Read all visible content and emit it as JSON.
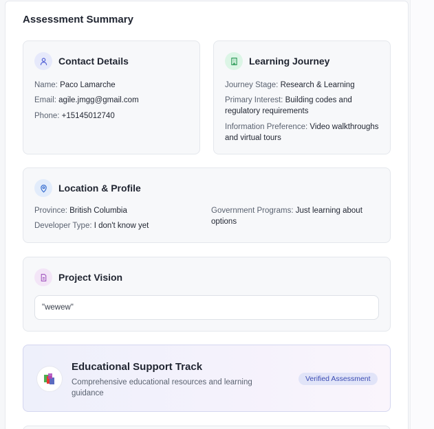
{
  "summary": {
    "title": "Assessment Summary"
  },
  "contact": {
    "title": "Contact Details",
    "name_label": "Name:",
    "name": "Paco Lamarche",
    "email_label": "Email:",
    "email": "agile.jmgg@gmail.com",
    "phone_label": "Phone:",
    "phone": "+15145012740"
  },
  "journey": {
    "title": "Learning Journey",
    "stage_label": "Journey Stage:",
    "stage": "Research & Learning",
    "interest_label": "Primary Interest:",
    "interest": "Building codes and regulatory requirements",
    "pref_label": "Information Preference:",
    "pref": "Video walkthroughs and virtual tours"
  },
  "location": {
    "title": "Location & Profile",
    "province_label": "Province:",
    "province": "British Columbia",
    "developer_label": "Developer Type:",
    "developer": "I don't know yet",
    "programs_label": "Government Programs:",
    "programs": "Just learning about options"
  },
  "vision": {
    "title": "Project Vision",
    "value": "\"wewew\""
  },
  "track": {
    "title": "Educational Support Track",
    "description": "Comprehensive educational resources and learning guidance",
    "badge": "Verified Assessment"
  },
  "colors": {
    "contact_icon_bg": "#e6e9fb",
    "contact_icon": "#5563d6",
    "journey_icon_bg": "#dcf5e6",
    "journey_icon": "#2e9c5a",
    "location_icon_bg": "#e2ecfb",
    "location_icon": "#3a6fd0",
    "vision_icon_bg": "#f3e5f7",
    "vision_icon": "#a45bc0",
    "badge_bg": "#e1e4f8",
    "badge_text": "#3b4bb3"
  },
  "icons": {
    "contact": "user-icon",
    "journey": "building-icon",
    "location": "map-pin-icon",
    "vision": "document-icon",
    "track": "books-icon"
  }
}
